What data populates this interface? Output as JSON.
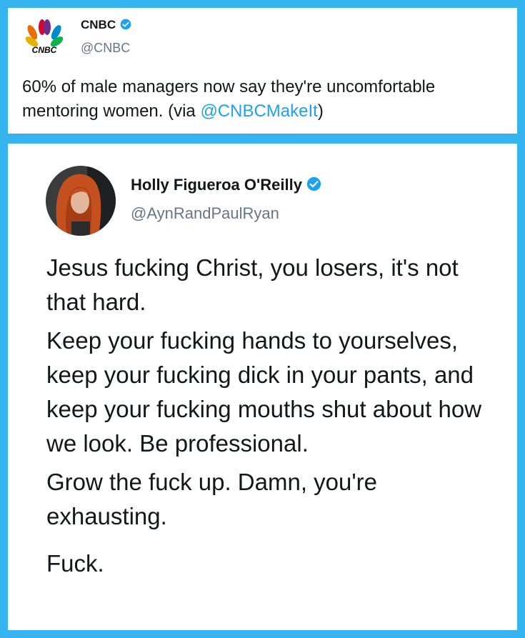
{
  "quoted_tweet": {
    "display_name": "CNBC",
    "handle": "@CNBC",
    "logo_text": "CNBC",
    "text_before_mention": "60% of male managers now say they're uncomfortable mentoring women. (via ",
    "mention": "@CNBCMakeIt",
    "text_after_mention": ")"
  },
  "main_tweet": {
    "display_name": "Holly Figueroa O'Reilly",
    "handle": "@AynRandPaulRyan",
    "paragraphs": [
      "Jesus fucking Christ, you losers, it's not that hard.",
      "Keep your fucking hands to yourselves, keep your fucking dick in your pants, and keep your fucking mouths shut about how we look. Be professional.",
      "Grow the fuck up. Damn, you're exhausting.",
      "Fuck."
    ]
  },
  "colors": {
    "background": "#35b4f0",
    "card": "#ffffff",
    "link": "#1da1f2",
    "verified": "#1da1f2",
    "text": "#14171a",
    "secondary_text": "#657786"
  },
  "icons": [
    "cnbc-peacock-logo",
    "verified-badge-icon",
    "avatar-photo"
  ]
}
